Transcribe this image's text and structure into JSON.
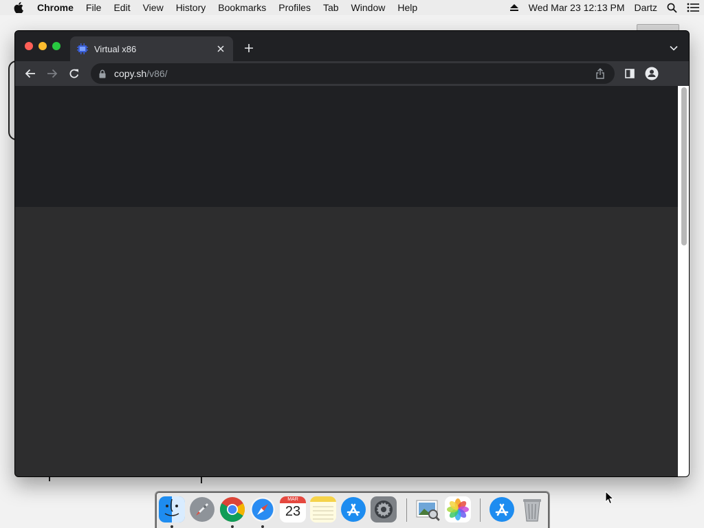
{
  "menubar": {
    "app_name": "Chrome",
    "menus": [
      "File",
      "Edit",
      "View",
      "History",
      "Bookmarks",
      "Profiles",
      "Tab",
      "Window",
      "Help"
    ],
    "clock": "Wed Mar 23  12:13 PM",
    "user": "Dartz"
  },
  "browser": {
    "tab": {
      "title": "Virtual x86"
    },
    "omnibox": {
      "host": "copy.sh",
      "path": "/v86/"
    }
  },
  "dock": {
    "calendar": {
      "month": "MAR",
      "day": "23"
    },
    "apps": [
      "Finder",
      "Launchpad",
      "Google Chrome",
      "Safari",
      "Calendar",
      "Notes",
      "App Store",
      "System Preferences",
      "Preview",
      "Photos",
      "App Store",
      "Trash"
    ]
  },
  "colors": {
    "chrome_frame": "#202124",
    "chrome_tab": "#35363a",
    "page_background": "#2d2d2e",
    "traffic_close": "#fe5f57",
    "traffic_minimize": "#febc2e",
    "traffic_maximize": "#28c840"
  }
}
